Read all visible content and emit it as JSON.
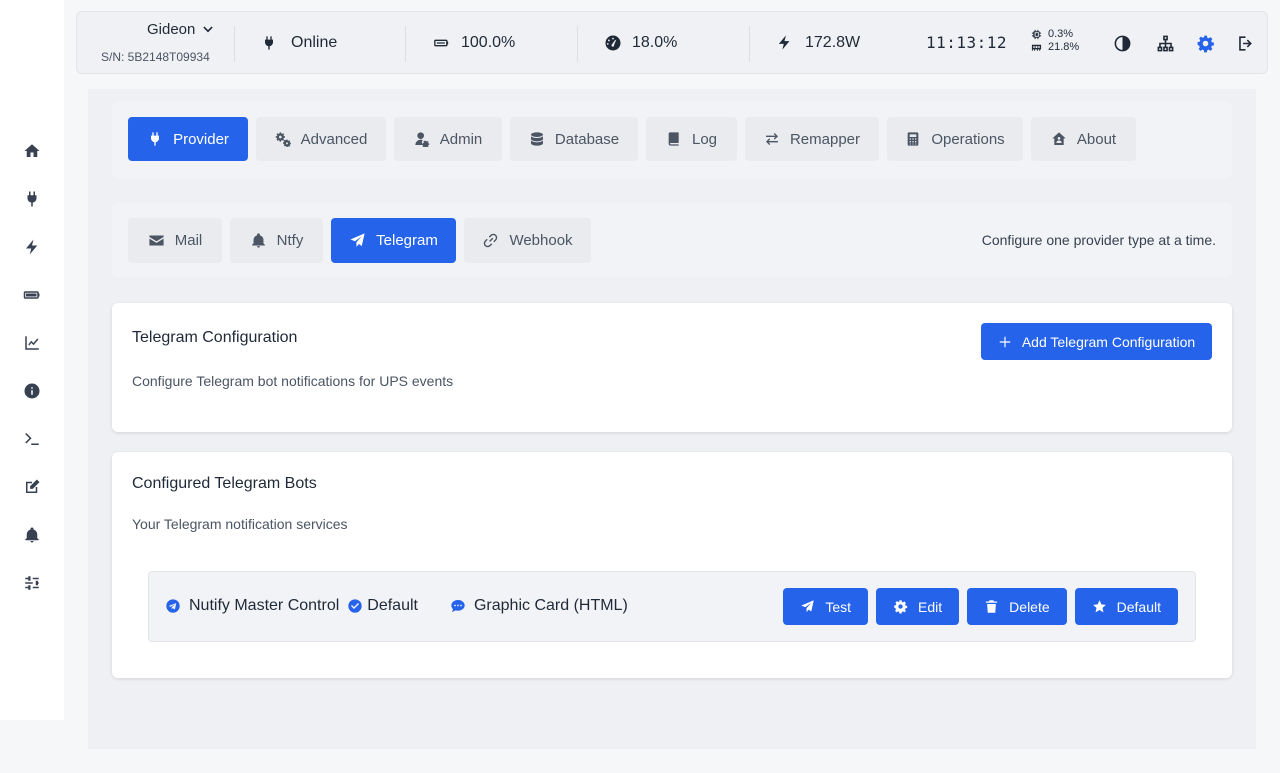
{
  "sidebar": {
    "items": [
      {
        "icon": "home-icon"
      },
      {
        "icon": "plug-icon"
      },
      {
        "icon": "bolt-icon"
      },
      {
        "icon": "battery-icon"
      },
      {
        "icon": "chart-line-icon"
      },
      {
        "icon": "info-icon"
      },
      {
        "icon": "terminal-icon"
      },
      {
        "icon": "edit-icon"
      },
      {
        "icon": "bell-icon"
      },
      {
        "icon": "sliders-icon"
      }
    ]
  },
  "header": {
    "device_name": "Gideon",
    "serial": "S/N: 5B2148T09934",
    "status": "Online",
    "battery": "100.0%",
    "load": "18.0%",
    "power": "172.8W",
    "time": "11:13:12",
    "cpu": "0.3%",
    "memory": "21.8%"
  },
  "tabs": [
    {
      "label": "Provider",
      "icon": "plug-icon",
      "active": true
    },
    {
      "label": "Advanced",
      "icon": "gears-icon",
      "active": false
    },
    {
      "label": "Admin",
      "icon": "user-gear-icon",
      "active": false
    },
    {
      "label": "Database",
      "icon": "database-icon",
      "active": false
    },
    {
      "label": "Log",
      "icon": "book-icon",
      "active": false
    },
    {
      "label": "Remapper",
      "icon": "arrows-exchange-icon",
      "active": false
    },
    {
      "label": "Operations",
      "icon": "calculator-icon",
      "active": false
    },
    {
      "label": "About",
      "icon": "house-user-icon",
      "active": false
    }
  ],
  "provider_tabs": [
    {
      "label": "Mail",
      "icon": "envelope-icon",
      "active": false
    },
    {
      "label": "Ntfy",
      "icon": "bell-icon",
      "active": false
    },
    {
      "label": "Telegram",
      "icon": "paper-plane-icon",
      "active": true
    },
    {
      "label": "Webhook",
      "icon": "link-icon",
      "active": false
    }
  ],
  "provider_hint": "Configure one provider type at a time.",
  "config_card": {
    "title": "Telegram Configuration",
    "subtitle": "Configure Telegram bot notifications for UPS events",
    "add_button": "Add Telegram Configuration"
  },
  "bots_card": {
    "title": "Configured Telegram Bots",
    "subtitle": "Your Telegram notification services",
    "bots": [
      {
        "name": "Nutify Master Control",
        "default_label": "Default",
        "format": "Graphic Card (HTML)",
        "actions": {
          "test": "Test",
          "edit": "Edit",
          "delete": "Delete",
          "default": "Default"
        }
      }
    ]
  },
  "colors": {
    "accent": "#2563eb",
    "background": "#eef0f3",
    "card": "#ffffff"
  }
}
